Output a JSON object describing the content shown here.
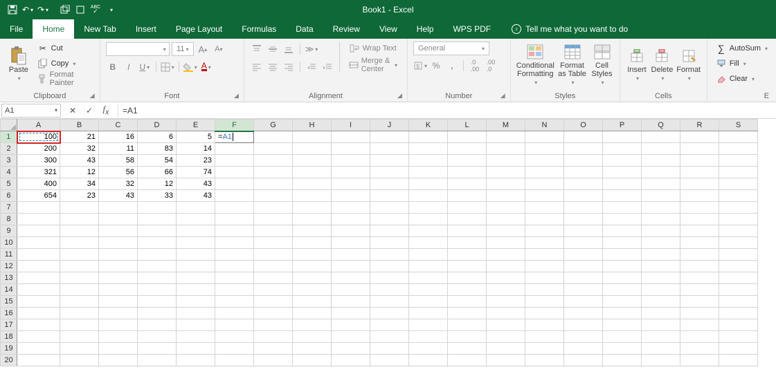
{
  "title": "Book1  -  Excel",
  "qat": {
    "save": "💾",
    "undo": "↶",
    "redo": "↷"
  },
  "tabs": {
    "file": "File",
    "home": "Home",
    "newtab": "New Tab",
    "insert": "Insert",
    "pagelayout": "Page Layout",
    "formulas": "Formulas",
    "data": "Data",
    "review": "Review",
    "view": "View",
    "help": "Help",
    "wps": "WPS PDF",
    "tellme": "Tell me what you want to do"
  },
  "ribbon": {
    "clipboard": {
      "paste": "Paste",
      "cut": "Cut",
      "copy": "Copy",
      "formatpainter": "Format Painter",
      "label": "Clipboard"
    },
    "font": {
      "name": "",
      "size": "11",
      "label": "Font"
    },
    "alignment": {
      "wrap": "Wrap Text",
      "merge": "Merge & Center",
      "label": "Alignment"
    },
    "number": {
      "format": "General",
      "label": "Number"
    },
    "styles": {
      "cond": "Conditional Formatting",
      "table": "Format as Table",
      "cell": "Cell Styles",
      "label": "Styles"
    },
    "cells": {
      "insert": "Insert",
      "delete": "Delete",
      "format": "Format",
      "label": "Cells"
    },
    "editing": {
      "autosum": "AutoSum",
      "fill": "Fill",
      "clear": "Clear",
      "label": "E"
    }
  },
  "fbar": {
    "namebox": "A1",
    "formula": "=A1"
  },
  "columns": [
    "A",
    "B",
    "C",
    "D",
    "E",
    "F",
    "G",
    "H",
    "I",
    "J",
    "K",
    "L",
    "M",
    "N",
    "O",
    "P",
    "Q",
    "R",
    "S"
  ],
  "active_col_index": 5,
  "rows": [
    1,
    2,
    3,
    4,
    5,
    6,
    7,
    8,
    9,
    10,
    11,
    12,
    13,
    14,
    15,
    16,
    17,
    18,
    19,
    20
  ],
  "active_row_index": 0,
  "data": {
    "r1": {
      "A": "100",
      "B": "21",
      "C": "16",
      "D": "6",
      "E": "5",
      "F_entry_prefix": "=",
      "F_entry_ref": "A1"
    },
    "r2": {
      "A": "200",
      "B": "32",
      "C": "11",
      "D": "83",
      "E": "14"
    },
    "r3": {
      "A": "300",
      "B": "43",
      "C": "58",
      "D": "54",
      "E": "23"
    },
    "r4": {
      "A": "321",
      "B": "12",
      "C": "56",
      "D": "66",
      "E": "74"
    },
    "r5": {
      "A": "400",
      "B": "34",
      "C": "32",
      "D": "12",
      "E": "43"
    },
    "r6": {
      "A": "654",
      "B": "23",
      "C": "43",
      "D": "33",
      "E": "43"
    }
  }
}
